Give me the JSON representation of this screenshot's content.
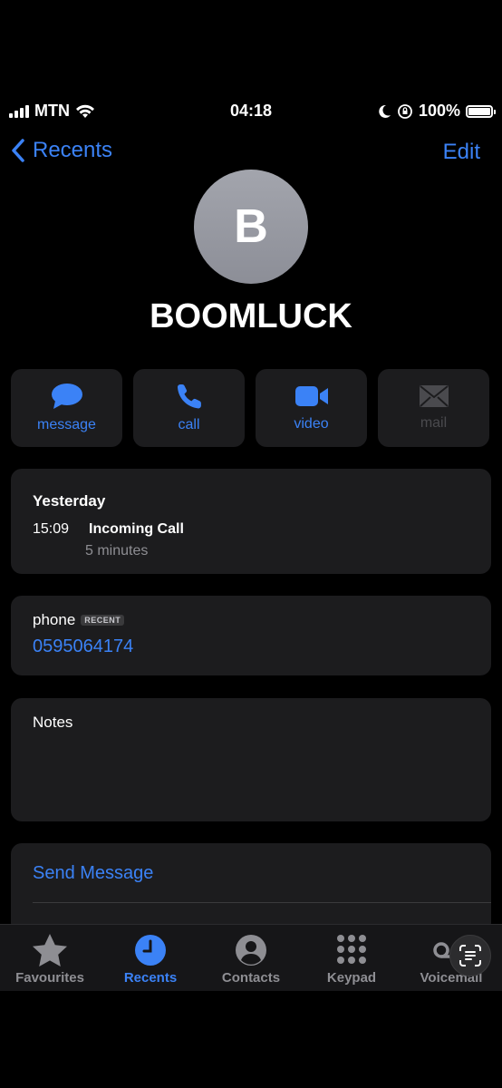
{
  "status_bar": {
    "carrier": "MTN",
    "time": "04:18",
    "battery": "100%"
  },
  "nav": {
    "back_label": "Recents",
    "edit_label": "Edit"
  },
  "contact": {
    "initial": "B",
    "name": "BOOMLUCK"
  },
  "actions": [
    {
      "label": "message",
      "icon": "message-bubble-icon",
      "enabled": true
    },
    {
      "label": "call",
      "icon": "phone-icon",
      "enabled": true
    },
    {
      "label": "video",
      "icon": "video-camera-icon",
      "enabled": true
    },
    {
      "label": "mail",
      "icon": "envelope-icon",
      "enabled": false
    }
  ],
  "call_history": {
    "day": "Yesterday",
    "time": "15:09",
    "type": "Incoming Call",
    "duration": "5 minutes"
  },
  "phone": {
    "label": "phone",
    "badge": "RECENT",
    "number": "0595064174"
  },
  "notes": {
    "label": "Notes"
  },
  "send_message": {
    "label": "Send Message"
  },
  "tabs": [
    {
      "label": "Favourites",
      "icon": "star-icon",
      "active": false
    },
    {
      "label": "Recents",
      "icon": "clock-icon",
      "active": true
    },
    {
      "label": "Contacts",
      "icon": "person-icon",
      "active": false
    },
    {
      "label": "Keypad",
      "icon": "keypad-icon",
      "active": false
    },
    {
      "label": "Voicemail",
      "icon": "voicemail-icon",
      "active": false
    }
  ],
  "colors": {
    "accent": "#3b82f6",
    "card": "#1c1c1e",
    "background": "#000000"
  }
}
